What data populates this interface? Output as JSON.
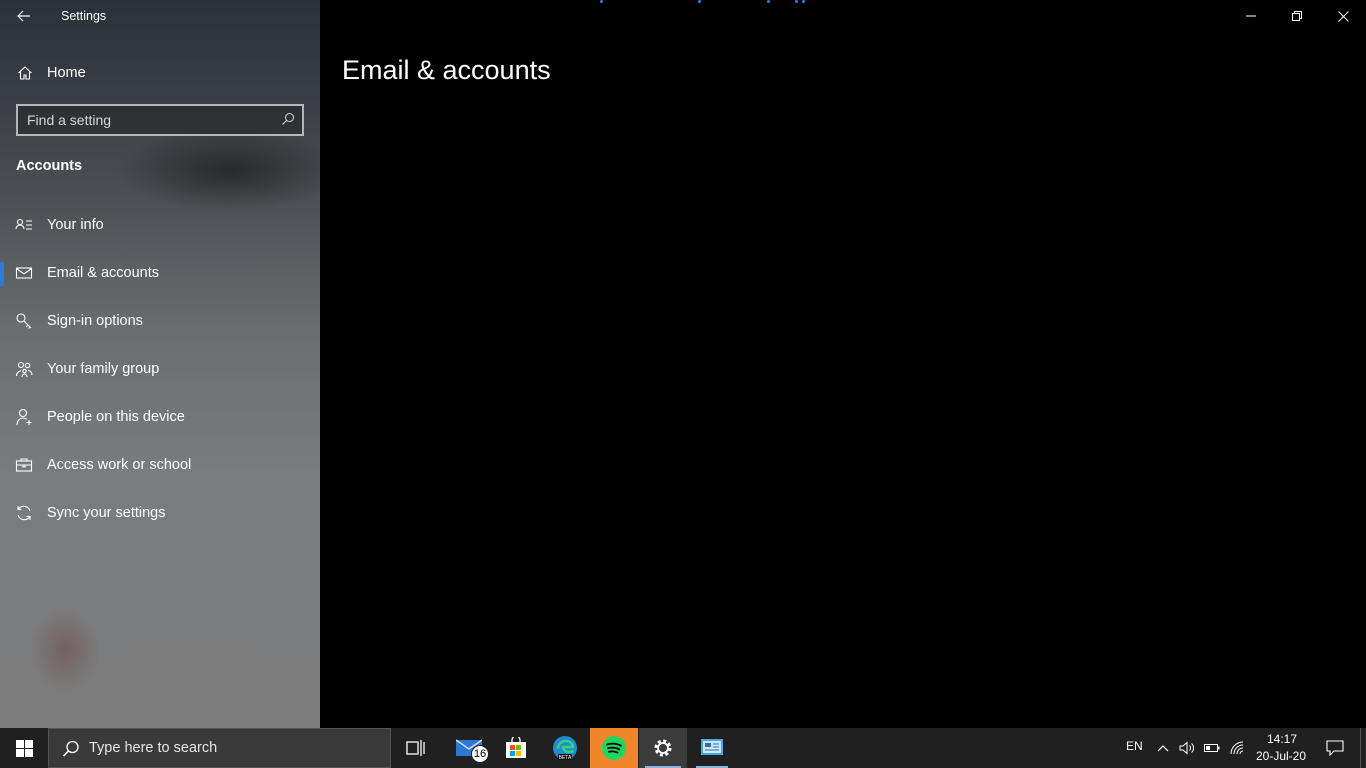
{
  "window": {
    "app_title": "Settings",
    "back_label": "Back",
    "controls": [
      "minimize",
      "restore",
      "close"
    ]
  },
  "sidebar": {
    "home_label": "Home",
    "search": {
      "placeholder": "Find a setting",
      "value": ""
    },
    "section_heading": "Accounts",
    "items": [
      {
        "label": "Your info",
        "icon": "contact-card-icon",
        "active": false
      },
      {
        "label": "Email & accounts",
        "icon": "mail-icon",
        "active": true
      },
      {
        "label": "Sign-in options",
        "icon": "key-icon",
        "active": false
      },
      {
        "label": "Your family group",
        "icon": "family-icon",
        "active": false
      },
      {
        "label": "People on this device",
        "icon": "add-person-icon",
        "active": false
      },
      {
        "label": "Access work or school",
        "icon": "briefcase-icon",
        "active": false
      },
      {
        "label": "Sync your settings",
        "icon": "sync-icon",
        "active": false
      }
    ]
  },
  "main": {
    "page_title": "Email & accounts"
  },
  "colors": {
    "accent": "#2b7ed6",
    "content_bg": "#000000",
    "taskbar_bg": "#202020",
    "spotify_active": "#f0862a"
  },
  "taskbar": {
    "search_placeholder": "Type here to search",
    "apps": [
      {
        "name": "task-view-icon"
      },
      {
        "name": "mail-app-icon",
        "badge": "16"
      },
      {
        "name": "microsoft-store-icon"
      },
      {
        "name": "edge-beta-icon"
      },
      {
        "name": "spotify-icon"
      },
      {
        "name": "settings-app-icon"
      },
      {
        "name": "control-panel-icon"
      }
    ],
    "tray": {
      "language": "EN",
      "time": "14:17",
      "date": "20-Jul-20"
    }
  }
}
